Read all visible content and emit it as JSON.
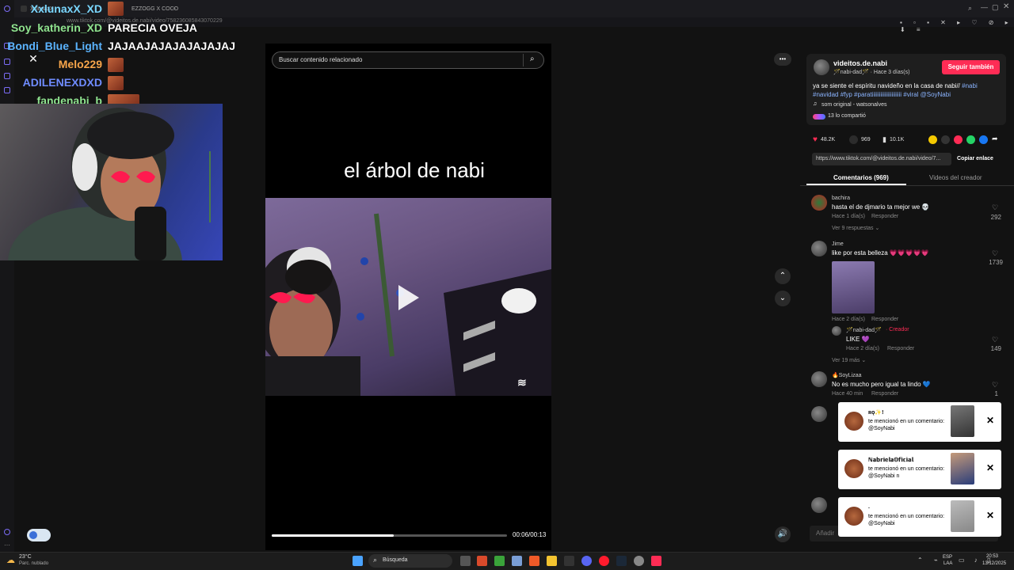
{
  "browser": {
    "tab1_label": "XxlunaxX",
    "tab2_label": "EZZOGG X COCO",
    "url_text": "www.tiktok.com/@videitos.de.nabi/video/758236085843070229",
    "new_tab": "+"
  },
  "chat": [
    {
      "name": "XxlunaxX_XD",
      "message": "",
      "color": "#7ad7ff"
    },
    {
      "name": "Soy_katherin_XD",
      "message": "PARECIA OVEJA",
      "color": "#8fe38f"
    },
    {
      "name": "Bondi_Blue_Light",
      "message": "JAJAAJAJAJAJAJAJAJ",
      "color": "#5bb4ff"
    },
    {
      "name": "Melo229",
      "message": "",
      "color": "#f7a54a"
    },
    {
      "name": "ADILENEXDXD",
      "message": "",
      "color": "#6f8cff"
    },
    {
      "name": "fandenabi_b",
      "message": "",
      "color": "#8fe38f"
    }
  ],
  "video": {
    "search_placeholder": "Buscar contenido relacionado",
    "overlay_title": "el árbol de nabi",
    "time": "00:06/00:13",
    "progress": 0.52,
    "more": "•••"
  },
  "post": {
    "author": "videitos.de.nabi",
    "sub": "🪄nabi-dad🪄 · Hace 3 días(s)",
    "follow_label": "Seguir también",
    "caption": "ya se siente el espíritu navideño en la casa de nabi//",
    "hashtags": "#nabi #navidad #fyp #paratiiiiiiiiiiiiiiiiiiiii #viral @SoyNabi",
    "sound": "som original - watsonalves",
    "shared": "13 lo compartió",
    "likes": "48.2K",
    "comments": "969",
    "saves": "10.1K",
    "link": "https://www.tiktok.com/@videitos.de.nabi/video/7...",
    "copy_label": "Copiar enlace"
  },
  "tabs": {
    "comments": "Comentarios (969)",
    "creator": "Videos del creador"
  },
  "comments": [
    {
      "user": "bachira",
      "text": "hasta el de djmario ta mejor we 💀",
      "time": "Hace 1 día(s)",
      "reply": "Responder",
      "likes": "292",
      "more": "Ver 9 respuestas ⌄"
    },
    {
      "user": "Jime",
      "text": "like por esta belleza 💗💗💗💗💗",
      "time": "Hace 2 día(s)",
      "reply": "Responder",
      "likes": "1739"
    },
    {
      "user": "🪄nabi-dad🪄",
      "creator_tag": "· Creador",
      "text": "LIKE 💜",
      "time": "Hace 2 día(s)",
      "reply": "Responder",
      "likes": "149",
      "more": "Ver 19 más ⌄"
    },
    {
      "user": "🔥SoyLizaa",
      "text": "No es mucho pero igual ta lindo 💙",
      "time": "Hace 40 min",
      "reply": "Responder",
      "likes": "1"
    }
  ],
  "add_comment_placeholder": "Añadir",
  "notifications": [
    {
      "title": "ʀǫ✨!",
      "text": "te mencionó en un comentario: @SoyNabi"
    },
    {
      "title": "ℕ𝕒𝕓𝕣𝕚𝕖𝕝𝕒𝕆𝕗𝕚𝕔𝕚𝕒𝕝",
      "text": "te mencionó en un comentario: @SoyNabi n"
    },
    {
      "title": ".",
      "text": "te mencionó en un comentario: @SoyNabi"
    }
  ],
  "taskbar": {
    "weather_temp": "23°C",
    "weather_desc": "Parc. nublado",
    "search": "Búsqueda",
    "lang1": "ESP",
    "lang2": "LAA",
    "time": "20:53",
    "date": "13/12/2025"
  },
  "colors": {
    "accent": "#fe2c55",
    "hashtag": "#8bb4ff",
    "heart": "#fe2c55"
  }
}
